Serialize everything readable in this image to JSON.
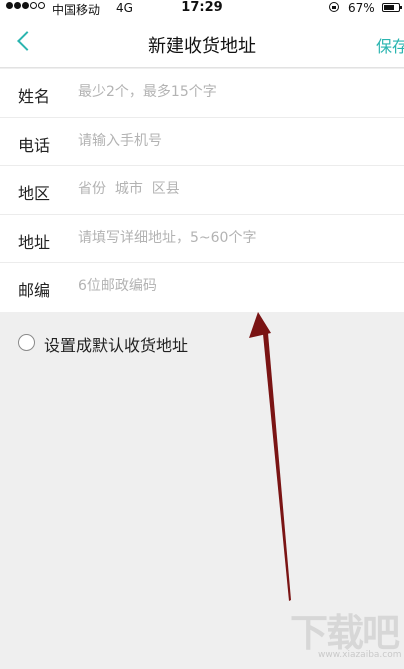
{
  "status_bar": {
    "carrier": "中国移动",
    "network": "4G",
    "time": "17:29",
    "battery_percent": "67%",
    "battery_level": 0.67
  },
  "nav": {
    "title": "新建收货地址",
    "save_label": "保存",
    "accent_color": "#2bb5b0"
  },
  "form": {
    "fields": [
      {
        "label": "姓名",
        "placeholder": "最少2个，最多15个字",
        "value": ""
      },
      {
        "label": "电话",
        "placeholder": "请输入手机号",
        "value": ""
      },
      {
        "label": "地区",
        "placeholder": "省份  城市  区县",
        "value": ""
      },
      {
        "label": "地址",
        "placeholder": "请填写详细地址，5~60个字",
        "value": ""
      },
      {
        "label": "邮编",
        "placeholder": "6位邮政编码",
        "value": ""
      }
    ]
  },
  "default_option": {
    "label": "设置成默认收货地址",
    "checked": false
  },
  "watermark": {
    "main_text": "下载吧",
    "sub_text": "www.xiazaiba.com"
  },
  "annotation": {
    "arrow_color": "#7a1414"
  }
}
